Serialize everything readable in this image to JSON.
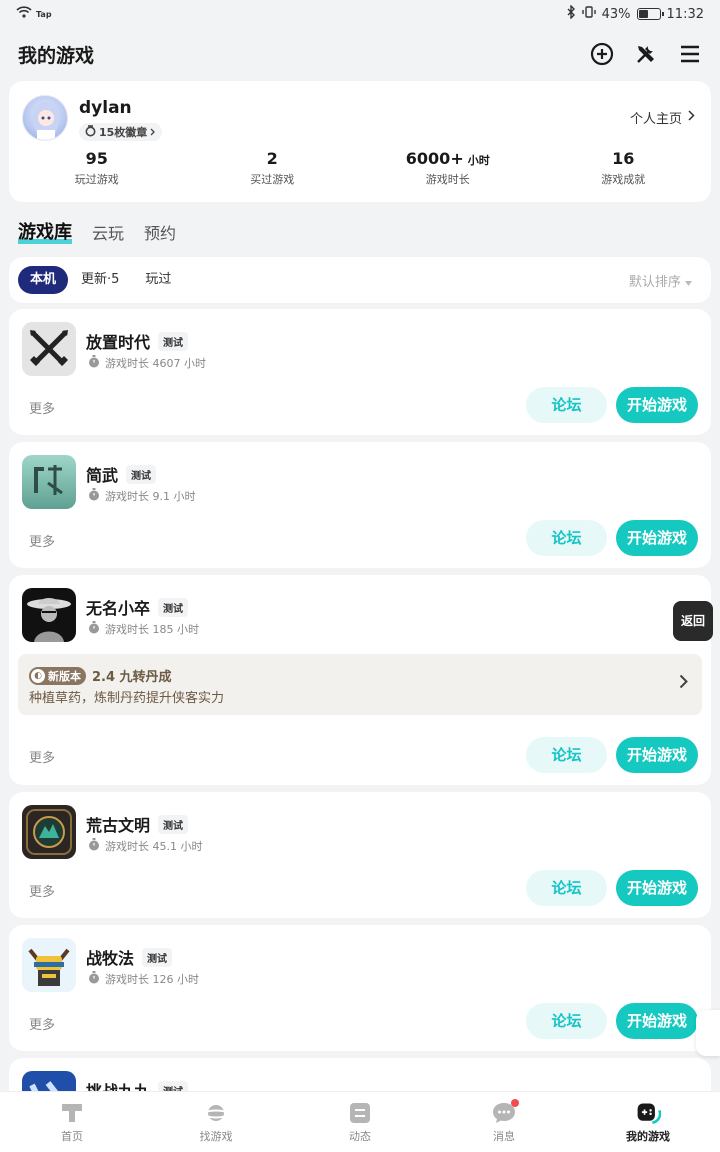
{
  "status": {
    "time": "11:32",
    "battery": "43%",
    "carrier_label": "Tap"
  },
  "header": {
    "title": "我的游戏"
  },
  "profile": {
    "username": "dylan",
    "badges": "15枚徽章",
    "homepage_link": "个人主页",
    "stats": [
      {
        "value": "95",
        "unit": "",
        "label": "玩过游戏"
      },
      {
        "value": "2",
        "unit": "",
        "label": "买过游戏"
      },
      {
        "value": "6000+",
        "unit": "小时",
        "label": "游戏时长"
      },
      {
        "value": "16",
        "unit": "",
        "label": "游戏成就"
      }
    ]
  },
  "library_tabs": [
    "游戏库",
    "云玩",
    "预约"
  ],
  "filters": {
    "chips": [
      "本机",
      "更新·5",
      "玩过"
    ],
    "sort": "默认排序"
  },
  "game_actions": {
    "more": "更多",
    "forum": "论坛",
    "start": "开始游戏"
  },
  "games": [
    {
      "name": "放置时代",
      "tag": "测试",
      "playtime": "游戏时长 4607 小时"
    },
    {
      "name": "简武",
      "tag": "测试",
      "playtime": "游戏时长 9.1 小时"
    },
    {
      "name": "无名小卒",
      "tag": "测试",
      "playtime": "游戏时长 185 小时",
      "update": {
        "tag": "新版本",
        "title": "2.4 九转丹成",
        "desc": "种植草药，炼制丹药提升侠客实力"
      }
    },
    {
      "name": "荒古文明",
      "tag": "测试",
      "playtime": "游戏时长 45.1 小时"
    },
    {
      "name": "战牧法",
      "tag": "测试",
      "playtime": "游戏时长 126 小时"
    },
    {
      "name": "挑战九九",
      "tag": "测试",
      "playtime": ""
    }
  ],
  "float_back": "返回",
  "bottom_nav": [
    {
      "label": "首页"
    },
    {
      "label": "找游戏"
    },
    {
      "label": "动态"
    },
    {
      "label": "消息"
    },
    {
      "label": "我的游戏"
    }
  ],
  "colors": {
    "accent": "#15c9c0",
    "chip_active": "#1f2a7a",
    "update_text": "#6b5a44"
  }
}
